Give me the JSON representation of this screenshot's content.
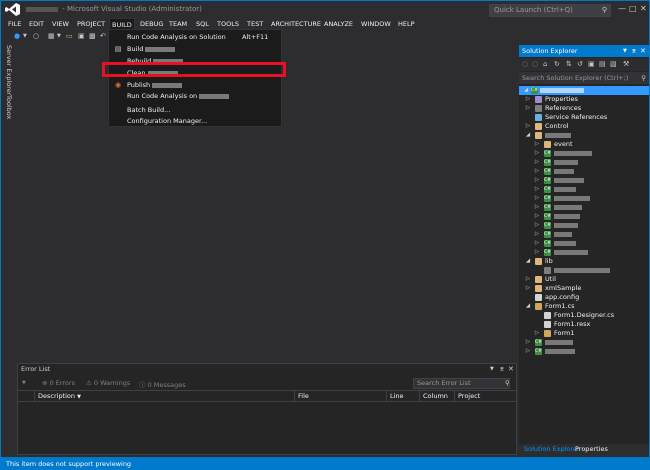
{
  "window": {
    "title_suffix": " - Microsoft Visual Studio (Administrator)",
    "quick_launch_placeholder": "Quick Launch (Ctrl+Q)",
    "accent": "#007acc",
    "highlight_color": "#e81123"
  },
  "menu": {
    "items": [
      "FILE",
      "EDIT",
      "VIEW",
      "PROJECT",
      "BUILD",
      "DEBUG",
      "TEAM",
      "SQL",
      "TOOLS",
      "TEST",
      "ARCHITECTURE",
      "ANALYZE",
      "WINDOW",
      "HELP"
    ],
    "active": "BUILD"
  },
  "build_menu": {
    "run_code_analysis_solution": "Run Code Analysis on Solution",
    "run_code_analysis_shortcut": "Alt+F11",
    "build_prefix": "Build ",
    "rebuild_prefix": "Rebuild ",
    "clean_prefix": "Clean ",
    "publish_prefix": "Publish ",
    "run_code_analysis_on": "Run Code Analysis on ",
    "batch_build": "Batch Build...",
    "configuration_manager": "Configuration Manager..."
  },
  "left_tabs": {
    "server_explorer": "Server Explorer",
    "toolbox": "Toolbox"
  },
  "error_list": {
    "title": "Error List",
    "errors": "0 Errors",
    "warnings": "0 Warnings",
    "messages": "0 Messages",
    "search_placeholder": "Search Error List",
    "columns": [
      "Description",
      "File",
      "Line",
      "Column",
      "Project"
    ]
  },
  "solution_explorer": {
    "title": "Solution Explorer",
    "search_placeholder": "Search Solution Explorer (Ctrl+;)",
    "tree": {
      "properties": "Properties",
      "references": "References",
      "service_references": "Service References",
      "control": "Control",
      "event": "event",
      "lib": "lib",
      "util": "Util",
      "xml_sample": "xmlSample",
      "app_config": "app.config",
      "form1_cs": "Form1.cs",
      "form1_designer": "Form1.Designer.cs",
      "form1_resx": "Form1.resx",
      "form1": "Form1"
    },
    "tabs": [
      "Solution Explorer",
      "Properties"
    ]
  },
  "status": {
    "text": "This item does not support previewing"
  }
}
